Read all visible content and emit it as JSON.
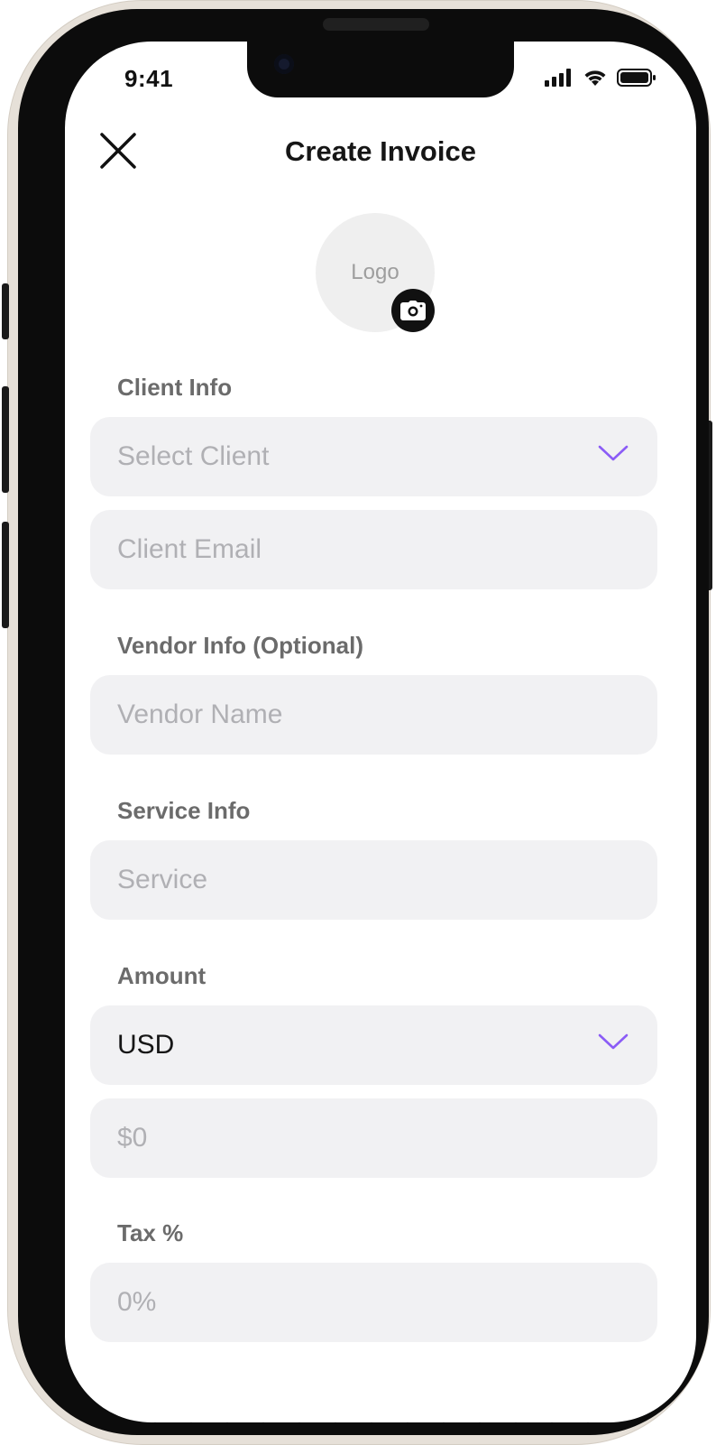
{
  "status_bar": {
    "time": "9:41"
  },
  "header": {
    "title": "Create Invoice"
  },
  "logo": {
    "label": "Logo"
  },
  "sections": {
    "client_info": {
      "label": "Client Info",
      "select_client_placeholder": "Select Client",
      "client_email_placeholder": "Client Email"
    },
    "vendor_info": {
      "label": "Vendor Info (Optional)",
      "vendor_name_placeholder": "Vendor Name"
    },
    "service_info": {
      "label": "Service Info",
      "service_placeholder": "Service"
    },
    "amount": {
      "label": "Amount",
      "currency_value": "USD",
      "amount_placeholder": "$0"
    },
    "tax": {
      "label": "Tax %",
      "tax_placeholder": "0%"
    }
  },
  "icons": {
    "close": "close-icon",
    "camera": "camera-icon",
    "chevron": "chevron-down-icon",
    "signal": "cellular-signal-icon",
    "wifi": "wifi-icon",
    "battery": "battery-icon"
  },
  "colors": {
    "accent": "#8b5cf6",
    "field_bg": "#f1f1f3",
    "placeholder": "#b0b0b4",
    "label": "#6b6b6b",
    "text": "#161616"
  }
}
